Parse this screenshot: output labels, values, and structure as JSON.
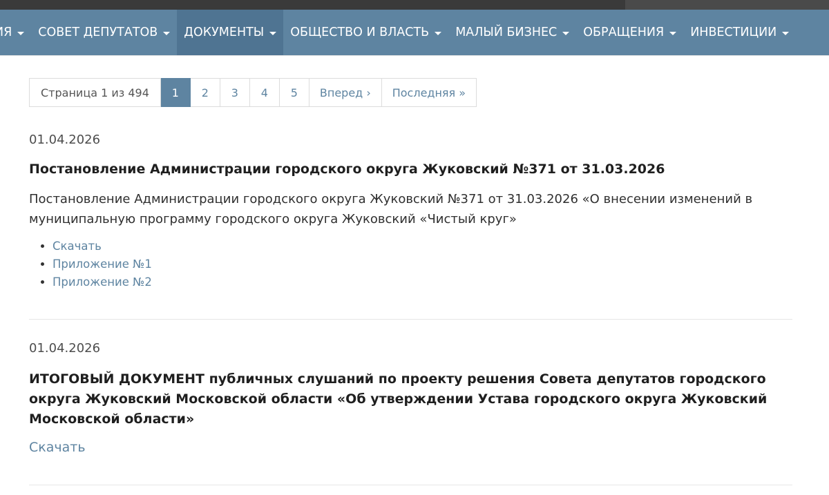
{
  "nav": {
    "items": [
      {
        "label": "ИЯ"
      },
      {
        "label": "СОВЕТ ДЕПУТАТОВ"
      },
      {
        "label": "ДОКУМЕНТЫ"
      },
      {
        "label": "ОБЩЕСТВО И ВЛАСТЬ"
      },
      {
        "label": "МАЛЫЙ БИЗНЕС"
      },
      {
        "label": "ОБРАЩЕНИЯ"
      },
      {
        "label": "ИНВЕСТИЦИИ"
      }
    ],
    "active_index": 2
  },
  "pagination": {
    "info": "Страница 1 из 494",
    "pages": [
      "1",
      "2",
      "3",
      "4",
      "5"
    ],
    "current_page": "1",
    "next": "Вперед ›",
    "last": "Последняя »"
  },
  "documents": [
    {
      "date": "01.04.2026",
      "title": "Постановление Администрации городского округа Жуковский №371 от 31.03.2026",
      "description": "Постановление Администрации городского округа Жуковский №371 от 31.03.2026 «О внесении изменений в муниципальную программу городского округа Жуковский «Чистый  круг»",
      "links": [
        "Скачать",
        "Приложение №1",
        "Приложение №2"
      ]
    },
    {
      "date": "01.04.2026",
      "title": "ИТОГОВЫЙ ДОКУМЕНТ публичных слушаний по проекту решения Совета депутатов городского округа Жуковский Московской области «Об утверждении Устава городского округа Жуковский Московской области»",
      "download": "Скачать"
    }
  ],
  "colors": {
    "nav_background": "#5e84a1",
    "nav_active": "#4f7492",
    "link": "#5e84a1"
  }
}
